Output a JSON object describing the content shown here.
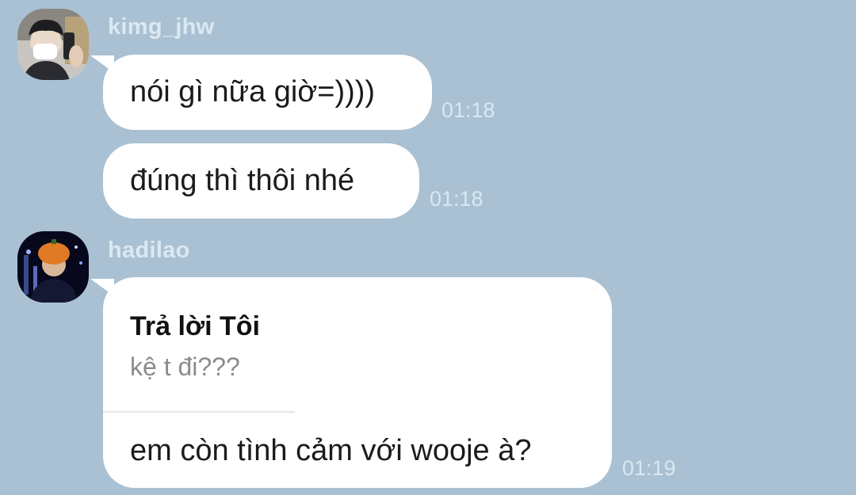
{
  "messages": [
    {
      "sender": "kimg_jhw",
      "avatar": "profile-photo-selfie",
      "bubbles": [
        {
          "text": "nói gì nữa giờ=))))",
          "time": "01:18"
        },
        {
          "text": "đúng thì thôi nhé",
          "time": "01:18"
        }
      ]
    },
    {
      "sender": "hadilao",
      "avatar": "profile-photo-orange-hat",
      "reply": {
        "title": "Trả lời Tôi",
        "quote": "kệ t đi???"
      },
      "bubbles": [
        {
          "text": "em còn tình cảm với wooje à?",
          "time": "01:19"
        }
      ]
    }
  ]
}
